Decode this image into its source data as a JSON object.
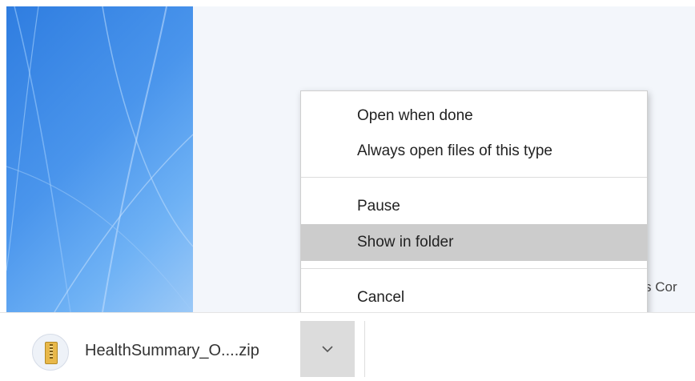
{
  "background": {
    "page_partial_text": "s Cor"
  },
  "download_bar": {
    "file_name": "HealthSummary_O....zip",
    "file_icon": "zip-archive-icon",
    "dropdown_icon": "chevron-down-icon"
  },
  "context_menu": {
    "items": [
      {
        "label": "Open when done"
      },
      {
        "label": "Always open files of this type"
      },
      {
        "label": "Pause"
      },
      {
        "label": "Show in folder",
        "highlighted": true
      },
      {
        "label": "Cancel"
      }
    ]
  },
  "colors": {
    "menu_highlight": "#cccccc",
    "wallpaper_blue": "#3d8ae6",
    "dropdown_button": "#dcdcdc"
  }
}
